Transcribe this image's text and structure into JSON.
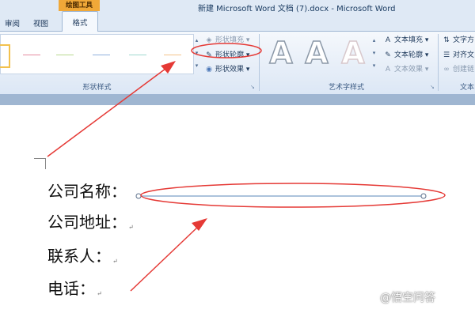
{
  "window": {
    "context_tab": "绘图工具",
    "title": "新建 Microsoft Word 文档 (7).docx - Microsoft Word"
  },
  "tabs": {
    "review": "审阅",
    "view": "视图",
    "format": "格式"
  },
  "ribbon": {
    "shape_styles_group": {
      "label": "形状样式",
      "shape_fill": "形状填充",
      "shape_outline": "形状轮廓",
      "shape_effects": "形状效果"
    },
    "wordart_group": {
      "label": "艺术字样式",
      "wordart_letter": "A",
      "text_fill": "文本填充",
      "text_outline": "文本轮廓",
      "text_effects": "文本效果"
    },
    "text_group": {
      "label": "文本",
      "text_direction": "文字方",
      "align_text": "对齐文",
      "create_link": "创建链"
    }
  },
  "document": {
    "lines": [
      "公司名称：",
      "公司地址：",
      "联系人：",
      "电话："
    ],
    "paragraph_mark": "↵"
  },
  "colors": {
    "annotation_red": "#e53935",
    "selected_line": "#7a9fc8",
    "shape_line_colors": [
      "#e58ba0",
      "#b8d890",
      "#8fb0dc",
      "#9fd8cf",
      "#f4c38a"
    ]
  },
  "watermark": "@悟空问答"
}
